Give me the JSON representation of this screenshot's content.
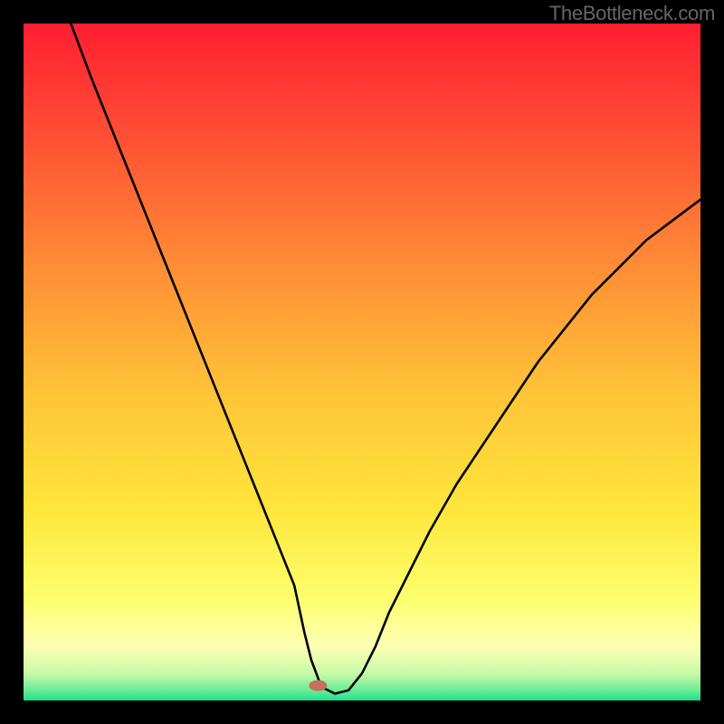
{
  "watermark": "TheBottleneck.com",
  "chart_data": {
    "type": "line",
    "title": "",
    "xlabel": "",
    "ylabel": "",
    "xlim": [
      0,
      100
    ],
    "ylim": [
      0,
      100
    ],
    "grid": false,
    "background_gradient": {
      "top": "#FF1E32",
      "mid": "#FFE63C",
      "bottom_yellowish": "#FDFFB4",
      "bottom_green": "#1EE08C"
    },
    "series": [
      {
        "name": "bottleneck-curve",
        "x": [
          7,
          10,
          12,
          14,
          16,
          18,
          20,
          22,
          24,
          26,
          28,
          30,
          32,
          34,
          36,
          38,
          40,
          41.5,
          42.5,
          44,
          46,
          48,
          50,
          52,
          54,
          57,
          60,
          64,
          68,
          72,
          76,
          80,
          84,
          88,
          92,
          96,
          100
        ],
        "y": [
          100,
          92,
          87,
          82,
          77,
          72,
          67,
          62,
          57,
          52,
          47,
          42,
          37,
          32,
          27,
          22,
          17,
          10,
          6,
          2,
          1,
          1.5,
          4,
          8,
          13,
          19,
          25,
          32,
          38,
          44,
          50,
          55,
          60,
          64,
          68,
          71,
          74
        ]
      }
    ],
    "marker": {
      "x_pct": 43.5,
      "y_pct": 2.2,
      "color": "#C86E5A",
      "rx": 10,
      "ry": 6
    }
  }
}
